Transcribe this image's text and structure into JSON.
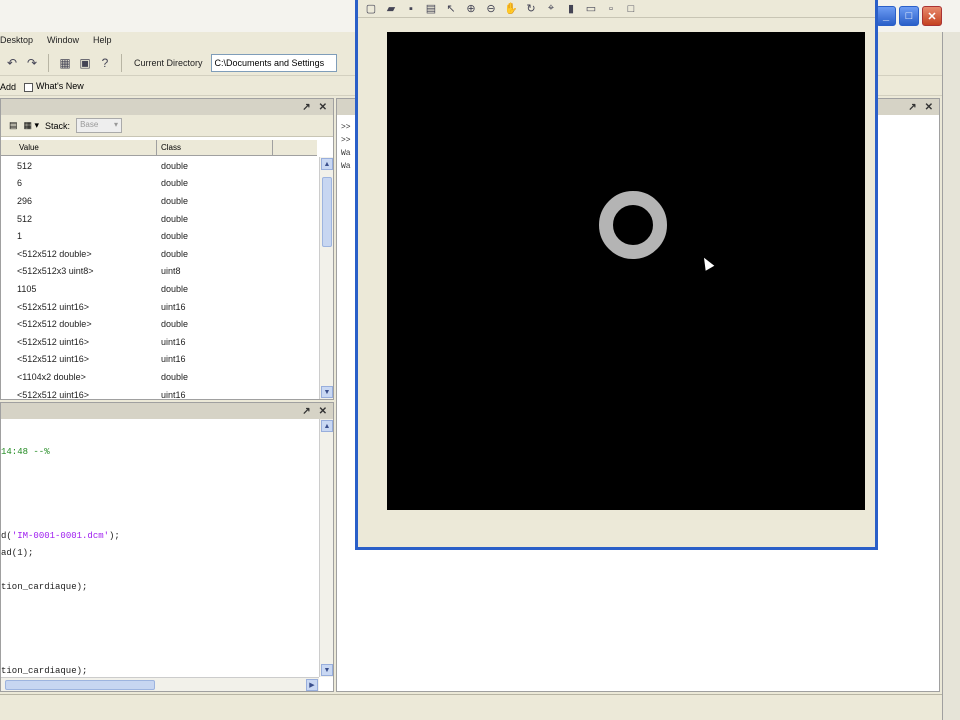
{
  "menu": {
    "items": [
      "Desktop",
      "Window",
      "Help"
    ]
  },
  "toolbar": {
    "current_directory_label": "Current Directory",
    "current_directory_value": "C:\\Documents and Settings"
  },
  "shortcuts": {
    "add_label": "Add",
    "whats_new_label": "What's New"
  },
  "workspace": {
    "stack_label": "Stack:",
    "stack_value": "Base",
    "columns": {
      "value": "Value",
      "class": "Class"
    },
    "rows": [
      {
        "value": "512",
        "class": "double"
      },
      {
        "value": "6",
        "class": "double"
      },
      {
        "value": "296",
        "class": "double"
      },
      {
        "value": "512",
        "class": "double"
      },
      {
        "value": "1",
        "class": "double"
      },
      {
        "value": "<512x512 double>",
        "class": "double"
      },
      {
        "value": "<512x512x3 uint8>",
        "class": "uint8"
      },
      {
        "value": "1105",
        "class": "double"
      },
      {
        "value": "<512x512 uint16>",
        "class": "uint16"
      },
      {
        "value": "<512x512 double>",
        "class": "double"
      },
      {
        "value": "<512x512 uint16>",
        "class": "uint16"
      },
      {
        "value": "<512x512 uint16>",
        "class": "uint16"
      },
      {
        "value": "<1104x2 double>",
        "class": "double"
      },
      {
        "value": "<512x512 uint16>",
        "class": "uint16"
      }
    ]
  },
  "editor": {
    "lines": [
      {
        "prefix": "",
        "string": "",
        "comment": "14:48 --%",
        "suffix": ""
      },
      {
        "prefix": "d(",
        "string": "'IM-0001-0001.dcm'",
        "comment": "",
        "suffix": ");"
      },
      {
        "prefix": "ad(1);",
        "string": "",
        "comment": "",
        "suffix": ""
      },
      {
        "prefix": "",
        "string": "",
        "comment": "",
        "suffix": ""
      },
      {
        "prefix": "tion_cardiaque);",
        "string": "",
        "comment": "",
        "suffix": ""
      },
      {
        "prefix": "",
        "string": "",
        "comment": "",
        "suffix": ""
      },
      {
        "prefix": "tion_cardiaque);",
        "string": "",
        "comment": "",
        "suffix": ""
      }
    ]
  },
  "command": {
    "lines": [
      ">>",
      ">>",
      "Wa",
      "Wa"
    ]
  },
  "colors": {
    "title_blue": "#2a5fc8",
    "xp_beige": "#ece9d8",
    "string_purple": "#a020f0",
    "comment_green": "#228b22",
    "image_background": "#000000",
    "ring_gray": "#b4b4b4"
  },
  "icons": {
    "figure_toolbar": [
      "new-icon",
      "open-icon",
      "save-icon",
      "print-icon",
      "pointer-icon",
      "zoom-in-icon",
      "zoom-out-icon",
      "pan-icon",
      "rotate-icon",
      "datacursor-icon",
      "colorbar-icon",
      "legend-icon",
      "hide-icon",
      "dock-icon"
    ]
  }
}
